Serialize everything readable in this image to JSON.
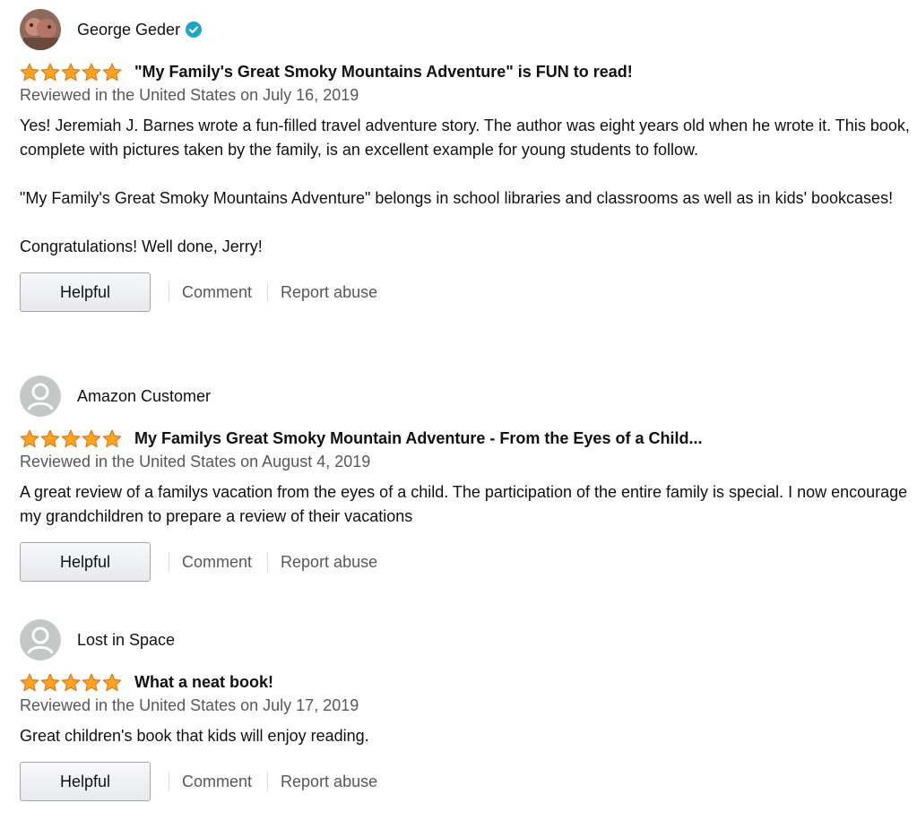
{
  "reviews": [
    {
      "author": "George Geder",
      "verified_icon": "verified-check-icon",
      "rating": 5,
      "title": "\"My Family's Great Smoky Mountains Adventure\" is FUN to read!",
      "date": "Reviewed in the United States on July 16, 2019",
      "paragraphs": [
        "Yes! Jeremiah J. Barnes wrote a fun-filled travel adventure story. The author was eight years old when he wrote it. This book, complete with pictures taken by the family, is an excellent example for young students to follow.",
        "\"My Family's Great Smoky Mountains Adventure\" belongs in school libraries and classrooms as well as in kids' bookcases!",
        "Congratulations! Well done, Jerry!"
      ],
      "helpful_label": "Helpful",
      "comment_label": "Comment",
      "report_label": "Report abuse"
    },
    {
      "author": "Amazon Customer",
      "rating": 5,
      "title": "My Familys Great Smoky Mountain Adventure - From the Eyes of a Child...",
      "date": "Reviewed in the United States on August 4, 2019",
      "paragraphs": [
        "A great review of a familys vacation from the eyes of a child. The participation of the entire family is special. I now encourage my grandchildren to prepare a review of their vacations"
      ],
      "helpful_label": "Helpful",
      "comment_label": "Comment",
      "report_label": "Report abuse"
    },
    {
      "author": "Lost in Space",
      "rating": 5,
      "title": "What a neat book!",
      "date": "Reviewed in the United States on July 17, 2019",
      "paragraphs": [
        "Great children's book that kids will enjoy reading."
      ],
      "helpful_label": "Helpful",
      "comment_label": "Comment",
      "report_label": "Report abuse"
    }
  ],
  "colors": {
    "star": "#ffa41c",
    "star_outline": "#de7921",
    "verified": "#1ea7c5",
    "link_gray": "#565959"
  }
}
